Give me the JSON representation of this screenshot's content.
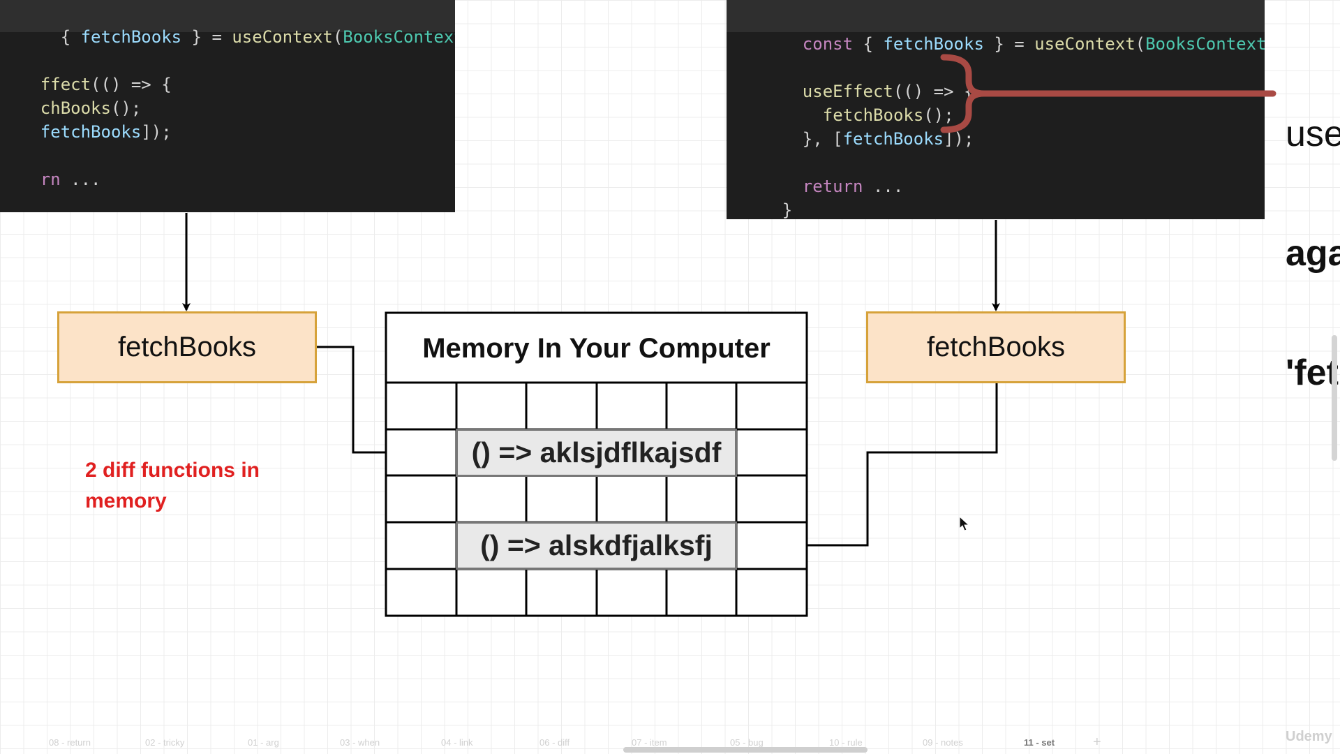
{
  "code_left": {
    "lines": {
      "l1": {
        "a": "  { ",
        "b": "fetchBooks",
        "c": " } = ",
        "d": "useContext",
        "e": "(",
        "f": "BooksContext",
        "g": ");"
      },
      "l2": {
        "a": "ffect",
        "b": "(() => {"
      },
      "l3": {
        "a": "chBooks",
        "b": "();"
      },
      "l4": {
        "a": "fetchBooks",
        "b": "]);"
      },
      "l5": {
        "a": "rn",
        "b": " ..."
      }
    }
  },
  "code_right": {
    "lines": {
      "l1": {
        "a": "const",
        "b": " { ",
        "c": "fetchBooks",
        "d": " } = ",
        "e": "useContext",
        "f": "(",
        "g": "BooksContext",
        "h": ");"
      },
      "l2": {
        "a": "useEffect",
        "b": "(() => {"
      },
      "l3": {
        "a": "fetchBooks",
        "b": "();"
      },
      "l4": {
        "a": "}, [",
        "b": "fetchBooks",
        "c": "]);"
      },
      "l5": {
        "a": "return",
        "b": " ..."
      },
      "l6": {
        "a": "}"
      }
    }
  },
  "side_text": [
    "use",
    "aga",
    "'fet"
  ],
  "diagram": {
    "box_left_label": "fetchBooks",
    "box_right_label": "fetchBooks",
    "memory_title": "Memory In Your Computer",
    "memory_fn_1": "() => aklsjdflkajsdf",
    "memory_fn_2": "() => alskdfjalksfj"
  },
  "note": {
    "line1": "2 diff functions in",
    "line2": "memory"
  },
  "colors": {
    "note": "#e02020",
    "box_fill": "#fce3c8",
    "box_border": "#d6a23a",
    "brace": "#a94a44",
    "code_bg": "#1e1e1e"
  },
  "tabs": [
    "08 - return",
    "02 - tricky",
    "01 - arg",
    "03 - when",
    "04 - link",
    "06 - diff",
    "07 - item",
    "05 - bug",
    "10 - rule",
    "09 - notes",
    "11 - set"
  ],
  "active_tab": "11 - set",
  "brand": "Udemy"
}
